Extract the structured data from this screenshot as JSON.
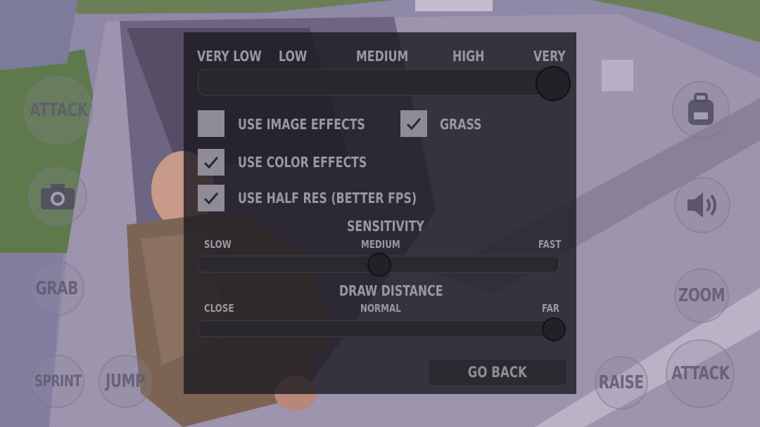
{
  "hud": {
    "attack_left": "ATTACK",
    "grab": "GRAB",
    "sprint": "SPRINT",
    "jump": "JUMP",
    "raise": "RAISE",
    "zoom": "ZOOM",
    "attack_right": "ATTACK"
  },
  "settings": {
    "quality": {
      "labels": [
        "VERY LOW",
        "LOW",
        "MEDIUM",
        "HIGH",
        "VERY"
      ],
      "value": 1.0
    },
    "toggles": {
      "image_effects": {
        "label": "USE IMAGE EFFECTS",
        "checked": false
      },
      "grass": {
        "label": "GRASS",
        "checked": true
      },
      "color_effects": {
        "label": "USE COLOR EFFECTS",
        "checked": true
      },
      "half_res": {
        "label": "USE HALF RES (BETTER FPS)",
        "checked": true
      }
    },
    "sensitivity": {
      "title": "SENSITIVITY",
      "min_label": "SLOW",
      "mid_label": "MEDIUM",
      "max_label": "FAST",
      "value": 0.5
    },
    "draw_distance": {
      "title": "DRAW DISTANCE",
      "min_label": "CLOSE",
      "mid_label": "NORMAL",
      "max_label": "FAR",
      "value": 1.0
    },
    "go_back_label": "GO BACK"
  }
}
